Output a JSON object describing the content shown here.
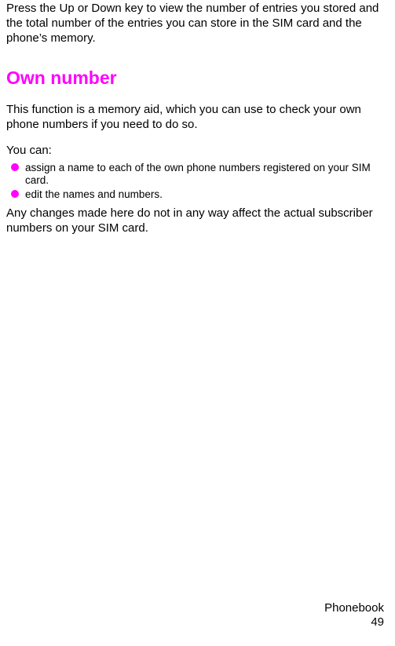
{
  "intro_paragraph": "Press the Up or Down key to view the number of entries you stored and the total number of the entries you can store in the SIM card and the phone’s memory.",
  "heading": "Own number",
  "heading_paragraph": "This function is a memory aid, which you can use to check your own phone numbers if you need to do so.",
  "you_can_label": "You can:",
  "bullets": [
    "assign a name to each of the own phone numbers registered on your SIM card.",
    "edit the names and numbers."
  ],
  "closing_paragraph": "Any changes made here do not in any way affect the actual subscriber numbers on your SIM card.",
  "footer_section": "Phonebook",
  "footer_page": "49"
}
